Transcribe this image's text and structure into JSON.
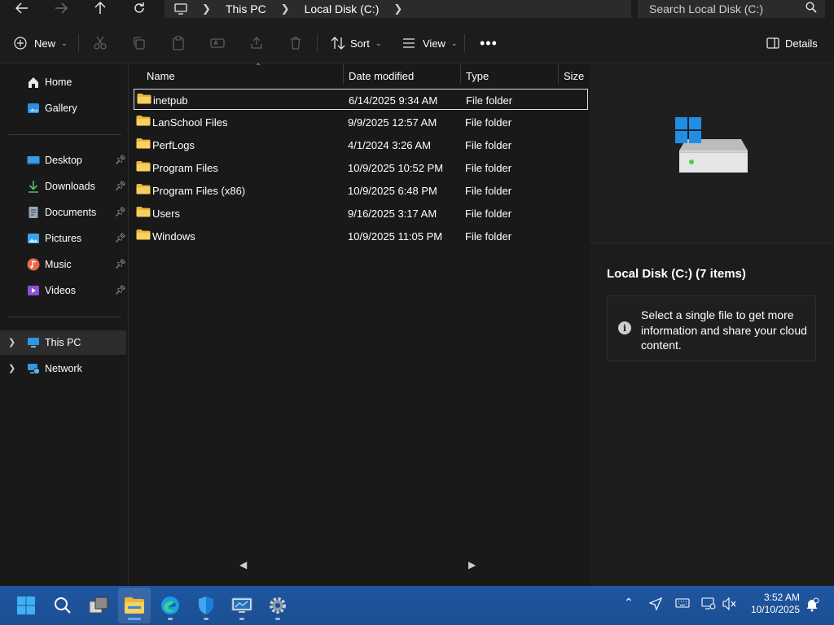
{
  "address": {
    "back_icon": "arrow-left-icon",
    "forward_icon": "arrow-right-icon",
    "up_icon": "arrow-up-icon",
    "refresh_icon": "refresh-icon",
    "breadcrumb": [
      "This PC",
      "Local Disk (C:)"
    ],
    "search_placeholder": "Search Local Disk (C:)"
  },
  "toolbar": {
    "new_label": "New",
    "sort_label": "Sort",
    "view_label": "View",
    "details_label": "Details"
  },
  "sidebar": {
    "top": [
      {
        "label": "Home",
        "icon": "home-icon"
      },
      {
        "label": "Gallery",
        "icon": "gallery-icon"
      }
    ],
    "pinned": [
      {
        "label": "Desktop",
        "icon": "desktop-icon"
      },
      {
        "label": "Downloads",
        "icon": "downloads-icon"
      },
      {
        "label": "Documents",
        "icon": "documents-icon"
      },
      {
        "label": "Pictures",
        "icon": "pictures-icon"
      },
      {
        "label": "Music",
        "icon": "music-icon"
      },
      {
        "label": "Videos",
        "icon": "videos-icon"
      }
    ],
    "locations": [
      {
        "label": "This PC",
        "icon": "computer-icon",
        "selected": true
      },
      {
        "label": "Network",
        "icon": "network-icon",
        "selected": false
      }
    ]
  },
  "columns": {
    "name": "Name",
    "date": "Date modified",
    "type": "Type",
    "size": "Size"
  },
  "files": [
    {
      "name": "inetpub",
      "date": "6/14/2025 9:34 AM",
      "type": "File folder"
    },
    {
      "name": "LanSchool Files",
      "date": "9/9/2025 12:57 AM",
      "type": "File folder"
    },
    {
      "name": "PerfLogs",
      "date": "4/1/2024 3:26 AM",
      "type": "File folder"
    },
    {
      "name": "Program Files",
      "date": "10/9/2025 10:52 PM",
      "type": "File folder"
    },
    {
      "name": "Program Files (x86)",
      "date": "10/9/2025 6:48 PM",
      "type": "File folder"
    },
    {
      "name": "Users",
      "date": "9/16/2025 3:17 AM",
      "type": "File folder"
    },
    {
      "name": "Windows",
      "date": "10/9/2025 11:05 PM",
      "type": "File folder"
    }
  ],
  "details": {
    "title": "Local Disk (C:) (7 items)",
    "info": "Select a single file to get more information and share your cloud content."
  },
  "taskbar": {
    "apps": [
      "start-icon",
      "search-icon",
      "task-view-icon",
      "file-explorer-icon",
      "edge-icon",
      "defender-icon",
      "remote-desktop-icon",
      "settings-icon"
    ],
    "time": "3:52 AM",
    "date": "10/10/2025"
  },
  "colors": {
    "background": "#191919",
    "taskbar": "#1c4f93",
    "folder": "#f3c74a",
    "accent": "#60a8ff"
  }
}
